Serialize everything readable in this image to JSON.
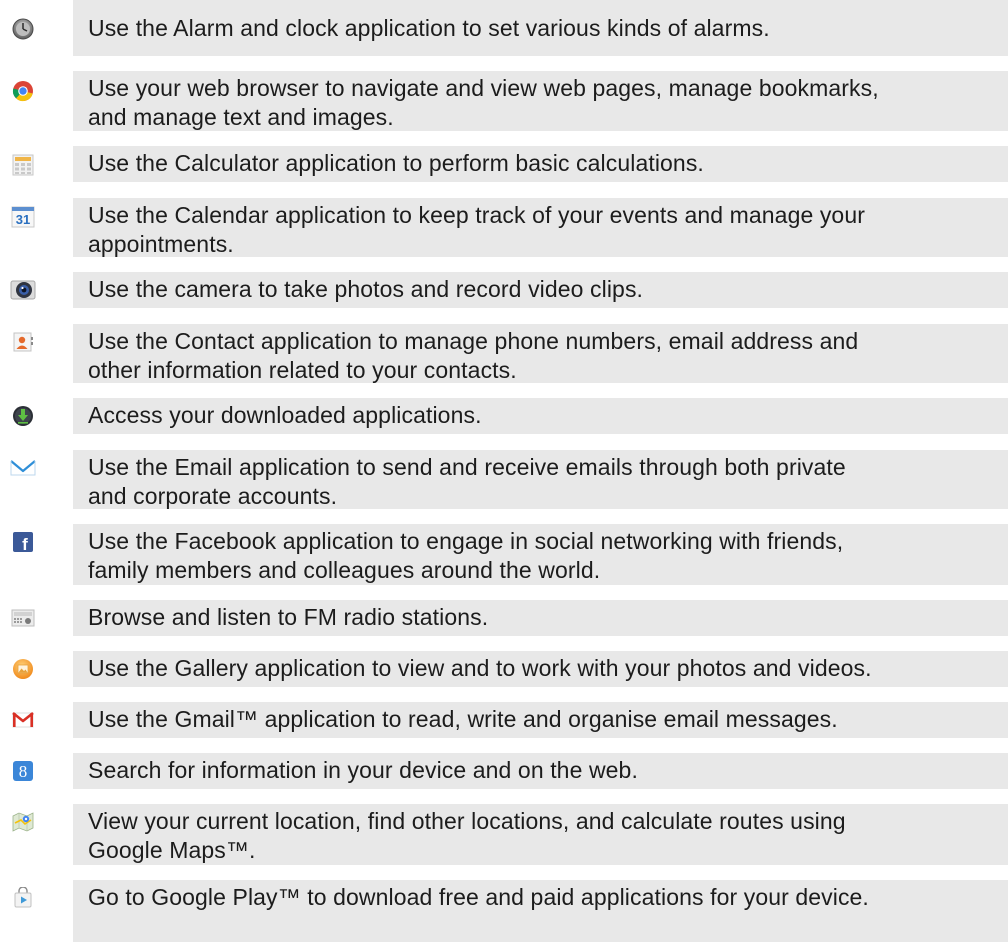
{
  "apps": [
    {
      "icon": "clock-icon",
      "text": "Use the Alarm and clock application to set various kinds of alarms."
    },
    {
      "icon": "browser-icon",
      "text": "Use your web browser to navigate and view web pages, manage bookmarks,\nand manage text and images."
    },
    {
      "icon": "calculator-icon",
      "text": "Use the Calculator application to perform basic calculations."
    },
    {
      "icon": "calendar-icon",
      "label": "31",
      "text": "Use the Calendar application to keep track of your events and manage your\nappointments."
    },
    {
      "icon": "camera-icon",
      "text": "Use the camera to take photos and record video clips."
    },
    {
      "icon": "contacts-icon",
      "text": "Use the Contact application to manage phone numbers, email address and\nother information related to your contacts."
    },
    {
      "icon": "download-icon",
      "text": "Access your downloaded applications."
    },
    {
      "icon": "email-icon",
      "text": "Use the Email application to send and receive emails through both private\nand corporate accounts."
    },
    {
      "icon": "facebook-icon",
      "label": "f",
      "text": "Use the Facebook application to engage in social networking with friends,\nfamily members and colleagues around the world."
    },
    {
      "icon": "fm-radio-icon",
      "text": "Browse and listen to FM radio stations."
    },
    {
      "icon": "gallery-icon",
      "text": "Use the Gallery application to view and to work with your photos and videos."
    },
    {
      "icon": "gmail-icon",
      "label": "M",
      "text": "Use the Gmail™ application to read, write and organise email messages."
    },
    {
      "icon": "google-search-icon",
      "label": "8",
      "text": "Search for information in your device and on the web."
    },
    {
      "icon": "maps-icon",
      "text": "View your current location, find other locations, and calculate routes using\nGoogle Maps™."
    },
    {
      "icon": "play-store-icon",
      "text": "Go to Google Play™ to download free and paid applications for your device."
    }
  ],
  "colors": {
    "band": "#e8e8e8",
    "text": "#1c1c1c",
    "facebook": "#3b5998",
    "calendar": "#2a6fbf",
    "gmail": "#d93025"
  }
}
